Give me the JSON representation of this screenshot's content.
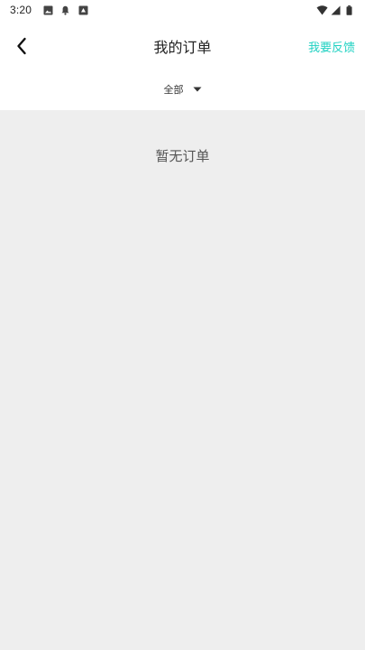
{
  "status_bar": {
    "time": "3:20",
    "left_icons": [
      "image-icon",
      "notification-bell-icon",
      "sim-icon"
    ],
    "right_icons": [
      "wifi-icon",
      "signal-icon",
      "battery-icon"
    ]
  },
  "header": {
    "back_icon": "chevron-left-icon",
    "title": "我的订单",
    "feedback_label": "我要反馈"
  },
  "filter": {
    "selected": "全部",
    "caret_icon": "caret-down-icon"
  },
  "content": {
    "empty_message": "暂无订单"
  },
  "colors": {
    "accent": "#1fd1c2",
    "background": "#eeeeee",
    "surface": "#ffffff"
  }
}
